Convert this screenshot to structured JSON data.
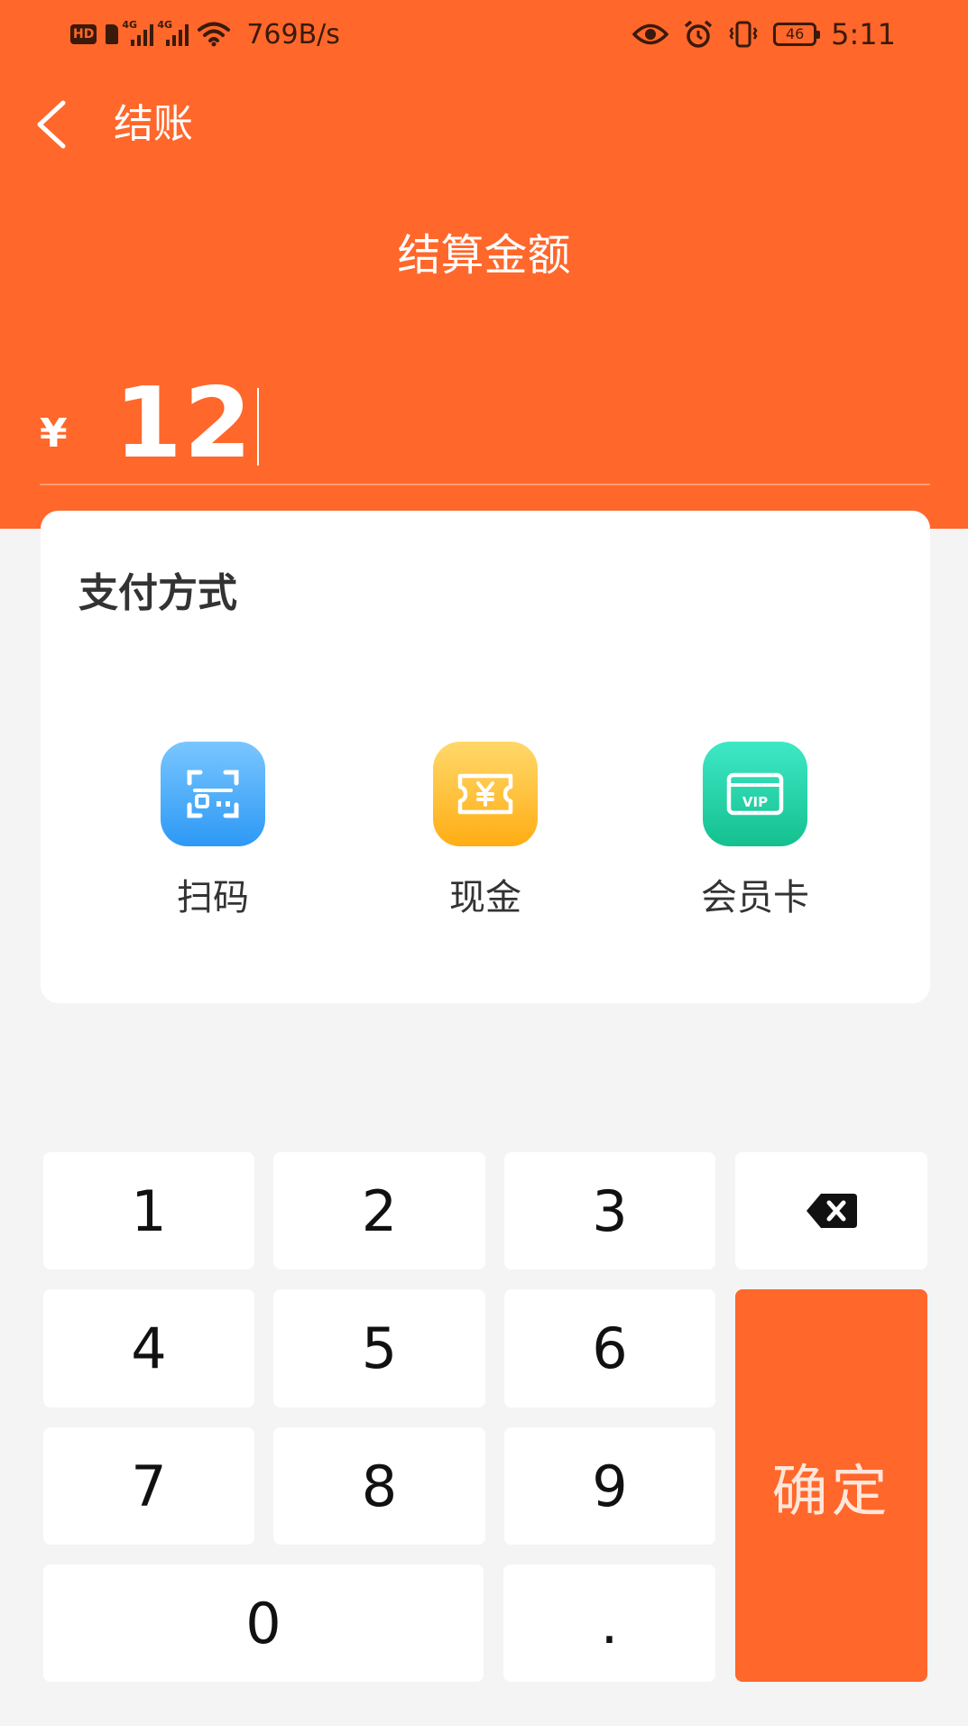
{
  "status_bar": {
    "hd": "HD",
    "signal1_tag": "4G",
    "signal2_tag": "4G",
    "speed": "769B/s",
    "battery": "46",
    "time": "5:11"
  },
  "nav": {
    "title": "结账"
  },
  "checkout": {
    "subtitle": "结算金额",
    "currency": "¥",
    "amount": "12"
  },
  "payment": {
    "title": "支付方式",
    "methods": [
      {
        "label": "扫码",
        "icon": "qr-scan-icon",
        "color": "#2d99f5"
      },
      {
        "label": "现金",
        "icon": "cash-ticket-icon",
        "color": "#ffad14"
      },
      {
        "label": "会员卡",
        "icon": "vip-card-icon",
        "color": "#14c08f"
      }
    ]
  },
  "keypad": {
    "keys": [
      "1",
      "2",
      "3",
      "4",
      "5",
      "6",
      "7",
      "8",
      "9",
      "0",
      "."
    ],
    "backspace_icon": "backspace-icon",
    "confirm": "确定"
  },
  "colors": {
    "accent": "#ff672b",
    "background": "#f4f4f4"
  }
}
